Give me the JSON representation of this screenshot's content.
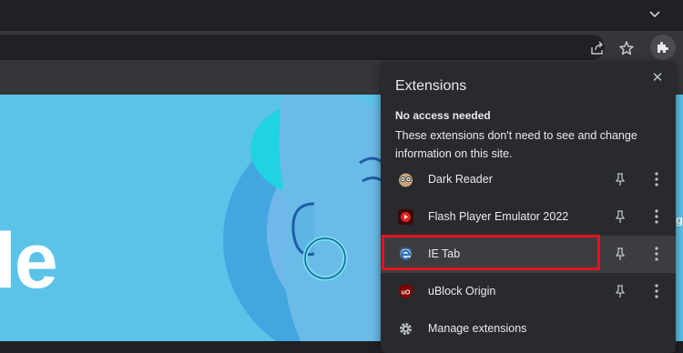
{
  "toolbar": {
    "icons": [
      "chevron-down-icon",
      "share-icon",
      "star-icon",
      "extensions-puzzle-icon"
    ]
  },
  "page": {
    "logo_text": "le",
    "edge_text": "g"
  },
  "extensions_panel": {
    "title": "Extensions",
    "close_label": "✕",
    "section_heading": "No access needed",
    "section_description": "These extensions don't need to see and change information on this site.",
    "items": [
      {
        "name": "Dark Reader",
        "icon": "dark-reader-icon"
      },
      {
        "name": "Flash Player Emulator 2022",
        "icon": "flash-player-icon"
      },
      {
        "name": "IE Tab",
        "icon": "ie-tab-icon"
      },
      {
        "name": "uBlock Origin",
        "icon": "ublock-origin-icon"
      }
    ],
    "manage_label": "Manage extensions",
    "highlighted_item": "IE Tab"
  },
  "colors": {
    "highlight": "#e3141c",
    "page_background": "#5cc3e8",
    "panel_background": "#292a2d"
  }
}
